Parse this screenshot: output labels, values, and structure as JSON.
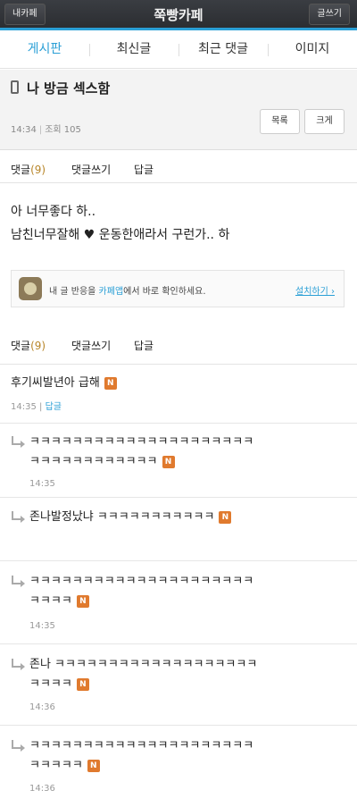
{
  "topbar": {
    "left_button": "내카페",
    "title": "쭉빵카페",
    "right_button": "글쓰기"
  },
  "tabs": [
    {
      "label": "게시판"
    },
    {
      "label": "최신글"
    },
    {
      "label": "최근 댓글"
    },
    {
      "label": "이미지"
    }
  ],
  "post": {
    "title": "나 방금 섹스함",
    "time": "14:34",
    "views": "조회 105",
    "list_button": "목록",
    "size_button": "크게",
    "body_line1": "아 너무좋다 하..",
    "body_line2": "남친너무잘해 ♥ 운동한애라서 구런가.. 하"
  },
  "comment_bar": {
    "label": "댓글",
    "count": "(9)",
    "write": "댓글쓰기",
    "reply": "답글"
  },
  "banner": {
    "text_before": "내 글 반응을 ",
    "app_name": "카페앱",
    "text_after": "에서 바로 확인하세요.",
    "install": "설치하기 ›"
  },
  "comments": [
    {
      "line1": "후기씨발년아 급해",
      "line2": "",
      "time": "14:35",
      "reply_label": "답글",
      "is_reply": false,
      "badge": "N"
    },
    {
      "line1": "ㅋㅋㅋㅋㅋㅋㅋㅋㅋㅋㅋㅋㅋㅋㅋㅋㅋㅋㅋㅋㅋ",
      "line2": "ㅋㅋㅋㅋㅋㅋㅋㅋㅋㅋㅋㅋ",
      "time": "14:35",
      "is_reply": true,
      "badge": "N"
    },
    {
      "line1": "존나발정났냐 ㅋㅋㅋㅋㅋㅋㅋㅋㅋㅋㅋ",
      "line2": "",
      "time": "",
      "is_reply": true,
      "badge": "N"
    },
    {
      "line1": "ㅋㅋㅋㅋㅋㅋㅋㅋㅋㅋㅋㅋㅋㅋㅋㅋㅋㅋㅋㅋㅋ",
      "line2": "ㅋㅋㅋㅋ",
      "time": "14:35",
      "is_reply": true,
      "badge": "N"
    },
    {
      "line1": "존나 ㅋㅋㅋㅋㅋㅋㅋㅋㅋㅋㅋㅋㅋㅋㅋㅋㅋㅋㅋ",
      "line2": "ㅋㅋㅋㅋ",
      "time": "14:36",
      "is_reply": true,
      "badge": "N"
    },
    {
      "line1": "ㅋㅋㅋㅋㅋㅋㅋㅋㅋㅋㅋㅋㅋㅋㅋㅋㅋㅋㅋㅋㅋ",
      "line2": "ㅋㅋㅋㅋㅋ",
      "time": "14:36",
      "is_reply": true,
      "badge": "N"
    }
  ]
}
